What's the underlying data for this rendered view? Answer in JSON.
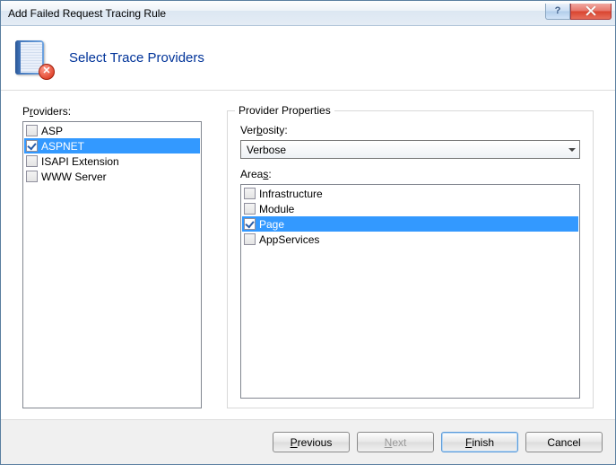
{
  "window": {
    "title": "Add Failed Request Tracing Rule"
  },
  "header": {
    "title": "Select Trace Providers"
  },
  "providers": {
    "label_pre": "P",
    "label_u": "r",
    "label_post": "oviders:",
    "items": [
      {
        "label": "ASP",
        "checked": false,
        "selected": false
      },
      {
        "label": "ASPNET",
        "checked": true,
        "selected": true
      },
      {
        "label": "ISAPI Extension",
        "checked": false,
        "selected": false
      },
      {
        "label": "WWW Server",
        "checked": false,
        "selected": false
      }
    ]
  },
  "properties": {
    "group_title": "Provider Properties",
    "verbosity": {
      "label_pre": "Ver",
      "label_u": "b",
      "label_post": "osity:",
      "value": "Verbose"
    },
    "areas": {
      "label_pre": "Area",
      "label_u": "s",
      "label_post": ":",
      "items": [
        {
          "label": "Infrastructure",
          "checked": false,
          "selected": false
        },
        {
          "label": "Module",
          "checked": false,
          "selected": false
        },
        {
          "label": "Page",
          "checked": true,
          "selected": true
        },
        {
          "label": "AppServices",
          "checked": false,
          "selected": false
        }
      ]
    }
  },
  "buttons": {
    "previous_u": "P",
    "previous_post": "revious",
    "next_u": "N",
    "next_post": "ext",
    "finish_u": "F",
    "finish_post": "inish",
    "cancel": "Cancel"
  }
}
